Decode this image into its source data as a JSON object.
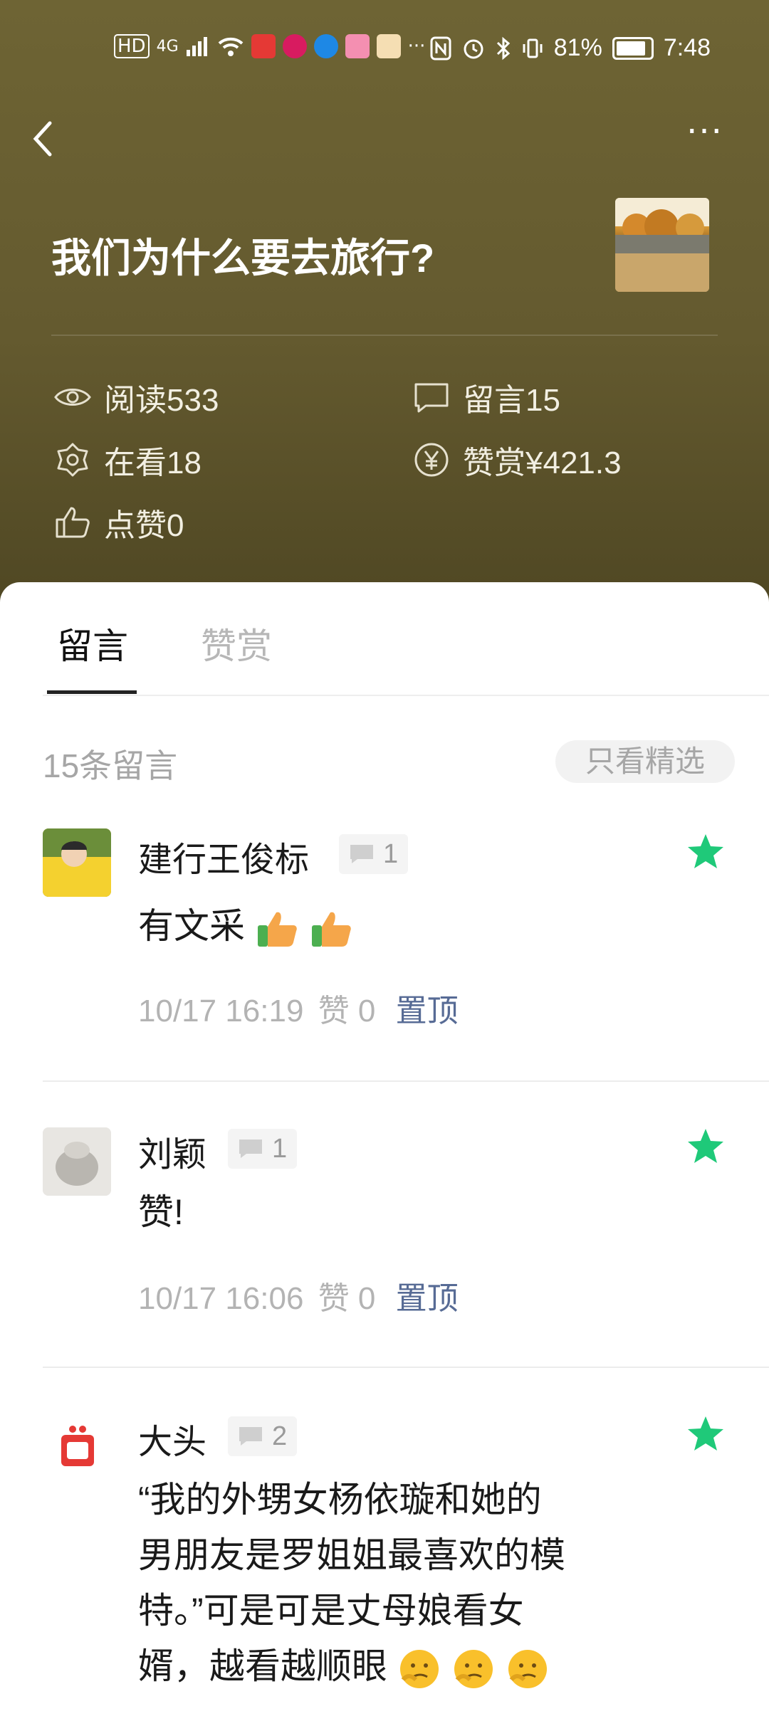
{
  "status_bar": {
    "network": "4G",
    "hd": "HD",
    "battery": "81%",
    "time": "7:48",
    "more": "···"
  },
  "header": {
    "title": "我们为什么要去旅行?",
    "more_glyph": "···"
  },
  "stats": {
    "reads": "阅读533",
    "comments": "留言15",
    "watching": "在看18",
    "rewards": "赞赏¥421.3",
    "likes": "点赞0"
  },
  "tabs": [
    {
      "label": "留言",
      "active": true
    },
    {
      "label": "赞赏",
      "active": false
    }
  ],
  "list_header": {
    "count_label": "15条留言",
    "filter_label": "只看精选"
  },
  "comments": [
    {
      "name": "建行王俊标",
      "replies": "1",
      "text": "有文采",
      "emoji_count": 2,
      "emoji": "thumbs-up",
      "time": "10/17 16:19",
      "likes": "赞 0",
      "pin_label": "置顶",
      "featured": true
    },
    {
      "name": "刘颖",
      "replies": "1",
      "text": "赞!",
      "time": "10/17 16:06",
      "likes": "赞 0",
      "pin_label": "置顶",
      "featured": true
    },
    {
      "name": "大头",
      "replies": "2",
      "text_lines": [
        "“我的外甥女杨依璇和她的",
        "男朋友是罗姐姐最喜欢的模",
        "特。”可是可是丈母娘看女",
        "婿，越看越顺眼"
      ],
      "emoji_count": 3,
      "emoji": "thinking-face",
      "featured": true
    }
  ],
  "colors": {
    "hero_bg": "#645a2f",
    "star": "#1fc979",
    "pin": "#576b95"
  }
}
